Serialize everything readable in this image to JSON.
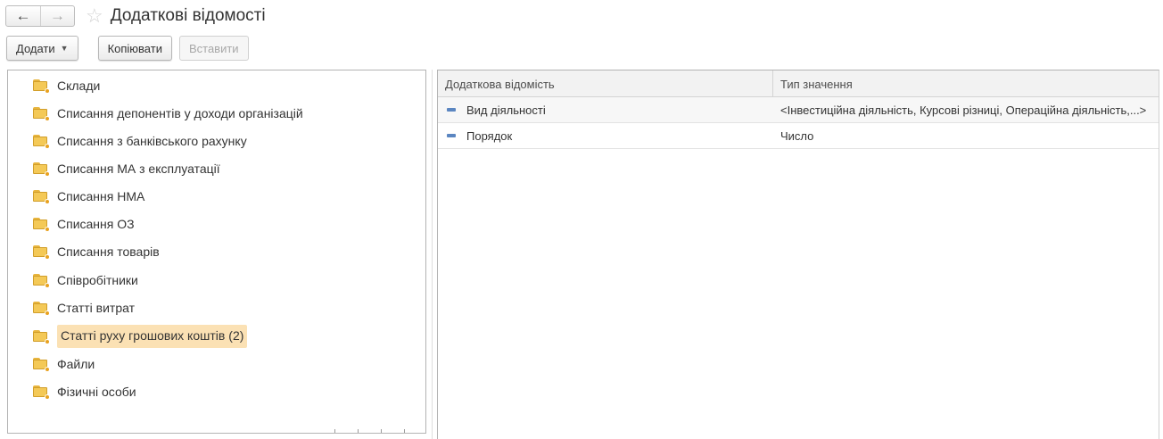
{
  "window": {
    "title": "Додаткові відомості",
    "back_icon": "←",
    "forward_icon": "→",
    "favorite_icon": "☆"
  },
  "toolbar": {
    "add_label": "Додати",
    "copy_label": "Копіювати",
    "paste_label": "Вставити"
  },
  "tree": {
    "items": [
      {
        "label": "Склади"
      },
      {
        "label": "Списання депонентів у доходи організацій"
      },
      {
        "label": "Списання з банківського рахунку"
      },
      {
        "label": "Списання МА з експлуатації"
      },
      {
        "label": "Списання НМА"
      },
      {
        "label": "Списання ОЗ"
      },
      {
        "label": "Списання товарів"
      },
      {
        "label": "Співробітники"
      },
      {
        "label": "Статті витрат"
      },
      {
        "label": "Статті руху грошових коштів",
        "count": "(2)"
      },
      {
        "label": "Файли"
      },
      {
        "label": "Фізичні особи"
      }
    ]
  },
  "grid": {
    "columns": [
      "Додаткова відомість",
      "Тип значення"
    ],
    "rows": [
      {
        "name": "Вид діяльності",
        "type": "<Інвестиційна діяльність, Курсові різниці, Операційна діяльність,...>"
      },
      {
        "name": "Порядок",
        "type": "Число"
      }
    ]
  },
  "colors": {
    "selected_bg": "#fbe1b4",
    "folder": "#f4c957",
    "attribute_icon": "#5b86c1"
  }
}
